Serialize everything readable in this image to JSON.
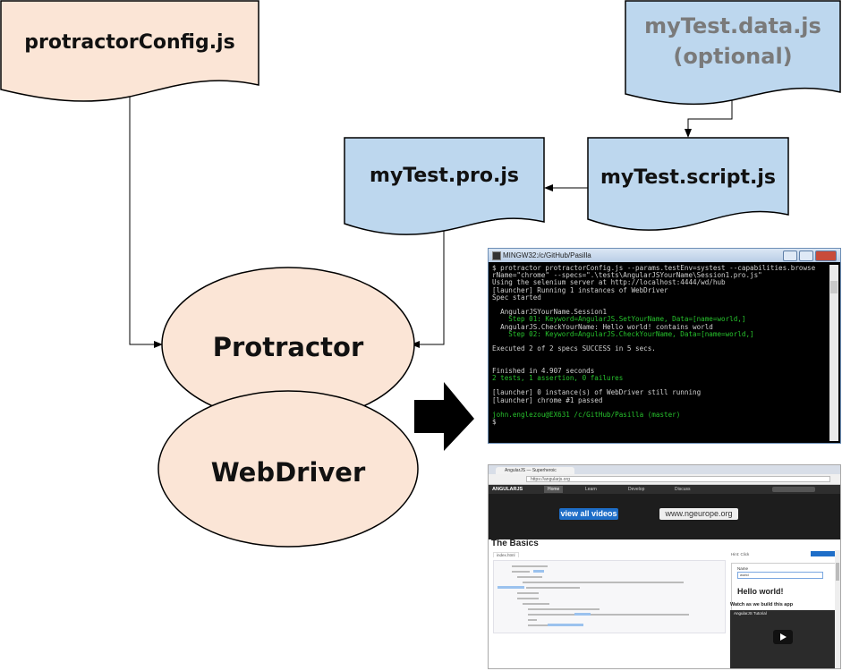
{
  "nodes": {
    "protractor_config": "protractorConfig.js",
    "data_file": "myTest.data.js",
    "data_file_note": "(optional)",
    "pro_file": "myTest.pro.js",
    "script_file": "myTest.script.js",
    "protractor": "Protractor",
    "webdriver": "WebDriver"
  },
  "colors": {
    "config_fill": "#fbe5d6",
    "file_fill": "#bdd7ee",
    "ellipse_fill": "#fbe5d6",
    "arrow": "#000000"
  },
  "terminal": {
    "title": "MINGW32:/c/GitHub/Pasilla",
    "lines": [
      {
        "text": "$ protractor protractorConfig.js --params.testEnv=systest --capabilities.browse",
        "c": ""
      },
      {
        "text": "rName=\"chrome\" --specs=\".\\tests\\AngularJSYourName\\Session1.pro.js\"",
        "c": ""
      },
      {
        "text": "Using the selenium server at http://localhost:4444/wd/hub",
        "c": ""
      },
      {
        "text": "[launcher] Running 1 instances of WebDriver",
        "c": ""
      },
      {
        "text": "Spec started",
        "c": ""
      },
      {
        "text": "",
        "c": ""
      },
      {
        "text": "  AngularJSYourName.Session1",
        "c": ""
      },
      {
        "text": "    Step 01: Keyword=AngularJS.SetYourName, Data=[name=world,]",
        "c": "g"
      },
      {
        "text": "  AngularJS.CheckYourName: Hello world! contains world",
        "c": ""
      },
      {
        "text": "    Step 02: Keyword=AngularJS.CheckYourName, Data=[name=world,]",
        "c": "g"
      },
      {
        "text": "",
        "c": ""
      },
      {
        "text": "Executed 2 of 2 specs SUCCESS in 5 secs.",
        "c": ""
      },
      {
        "text": "",
        "c": ""
      },
      {
        "text": "",
        "c": ""
      },
      {
        "text": "Finished in 4.907 seconds",
        "c": ""
      },
      {
        "text": "2 tests, 1 assertion, 0 failures",
        "c": "g"
      },
      {
        "text": "",
        "c": ""
      },
      {
        "text": "[launcher] 0 instance(s) of WebDriver still running",
        "c": ""
      },
      {
        "text": "[launcher] chrome #1 passed",
        "c": ""
      },
      {
        "text": "",
        "c": ""
      },
      {
        "text": "john.englezou@EX631 /c/GitHub/Pasilla (master)",
        "c": "g"
      },
      {
        "text": "$",
        "c": ""
      }
    ]
  },
  "browser": {
    "tab": "AngularJS — Superheroic",
    "url": "https://angularjs.org",
    "nav_logo": "ANGULARJS",
    "nav_items": [
      "Home",
      "Learn",
      "Develop",
      "Discuss"
    ],
    "search": "Search",
    "banner_button": "view all videos",
    "banner_link": "www.ngeurope.org",
    "heading": "The Basics",
    "code_tab": "index.html",
    "side_label": "Hint: Click",
    "side_button": "Edit Me",
    "demo_name_label": "Name",
    "demo_input": "world",
    "demo_hello": "Hello world!",
    "watch_text": "Watch as we build this app",
    "video_title": "AngularJS Tutorial"
  }
}
